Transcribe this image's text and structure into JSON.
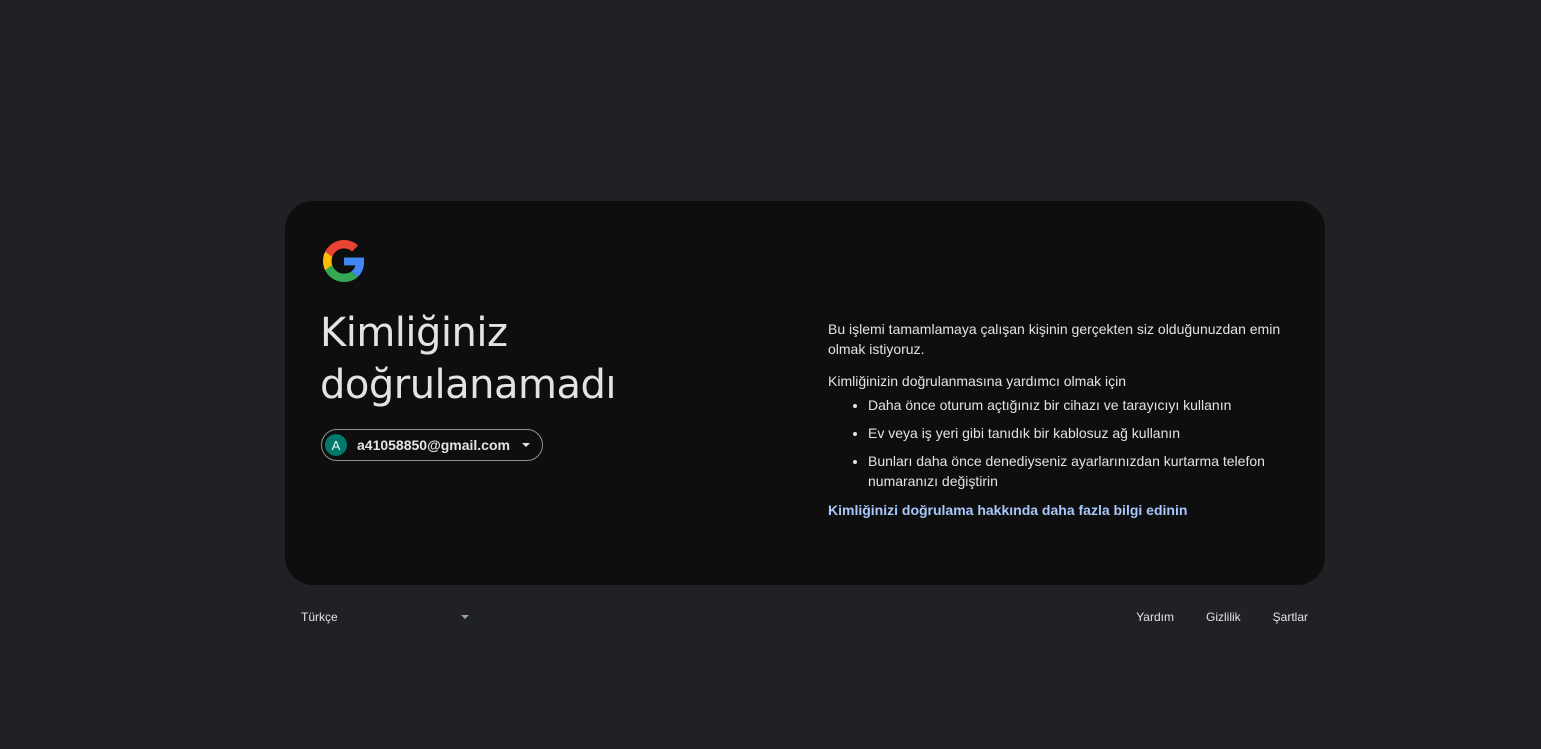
{
  "card": {
    "logo": "google-g-logo",
    "title": "Kimliğiniz doğrulanamadı",
    "account": {
      "avatar_letter": "A",
      "email": "a41058850@gmail.com",
      "avatar_color": "#00796b"
    },
    "intro": "Bu işlemi tamamlamaya çalışan kişinin gerçekten siz olduğunuzdan emin olmak istiyoruz.",
    "help_heading": "Kimliğinizin doğrulanmasına yardımcı olmak için",
    "tips": [
      "Daha önce oturum açtığınız bir cihazı ve tarayıcıyı kullanın",
      "Ev veya iş yeri gibi tanıdık bir kablosuz ağ kullanın",
      "Bunları daha önce denediyseniz ayarlarınızdan kurtarma telefon numaranızı değiştirin"
    ],
    "learn_more": "Kimliğinizi doğrulama hakkında daha fazla bilgi edinin"
  },
  "footer": {
    "language": "Türkçe",
    "links": {
      "help": "Yardım",
      "privacy": "Gizlilik",
      "terms": "Şartlar"
    }
  },
  "colors": {
    "page_background": "#202124",
    "card_background": "#0e0e0e",
    "link": "#a8c7fa"
  }
}
